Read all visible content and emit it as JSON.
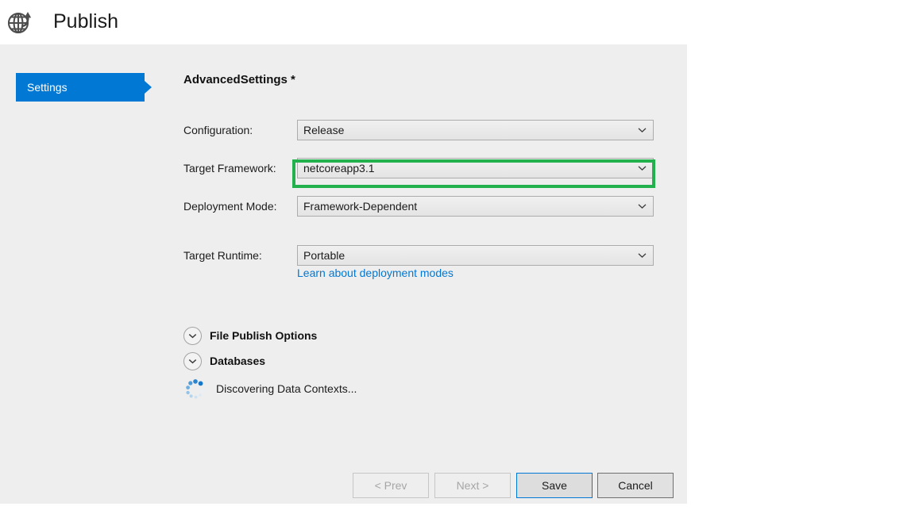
{
  "header": {
    "title": "Publish",
    "icon": "globe-publish-icon"
  },
  "sidebar": {
    "items": [
      {
        "label": "Settings",
        "selected": true
      }
    ]
  },
  "main": {
    "panel_title": "AdvancedSettings *",
    "fields": [
      {
        "label": "Configuration:",
        "value": "Release"
      },
      {
        "label": "Target Framework:",
        "value": "netcoreapp3.1"
      },
      {
        "label": "Deployment Mode:",
        "value": "Framework-Dependent"
      },
      {
        "label": "Target Runtime:",
        "value": "Portable"
      }
    ],
    "link": {
      "text": "Learn about deployment modes"
    },
    "expanders": [
      {
        "label": "File Publish Options",
        "icon": "chevron-down-icon"
      },
      {
        "label": "Databases",
        "icon": "chevron-down-icon"
      }
    ],
    "status": {
      "text": "Discovering Data Contexts...",
      "icon": "loading-spinner-icon"
    }
  },
  "annotation": {
    "color": "#22b14c",
    "target": "configuration-combobox"
  },
  "footer": {
    "buttons": [
      {
        "label": "< Prev",
        "state": "disabled"
      },
      {
        "label": "Next >",
        "state": "disabled"
      },
      {
        "label": "Save",
        "state": "default"
      },
      {
        "label": "Cancel",
        "state": "normal"
      }
    ]
  },
  "colors": {
    "accent": "#0078d4",
    "dialog_bg": "#eeeeee",
    "annotation": "#22b14c",
    "link": "#0078d4"
  }
}
